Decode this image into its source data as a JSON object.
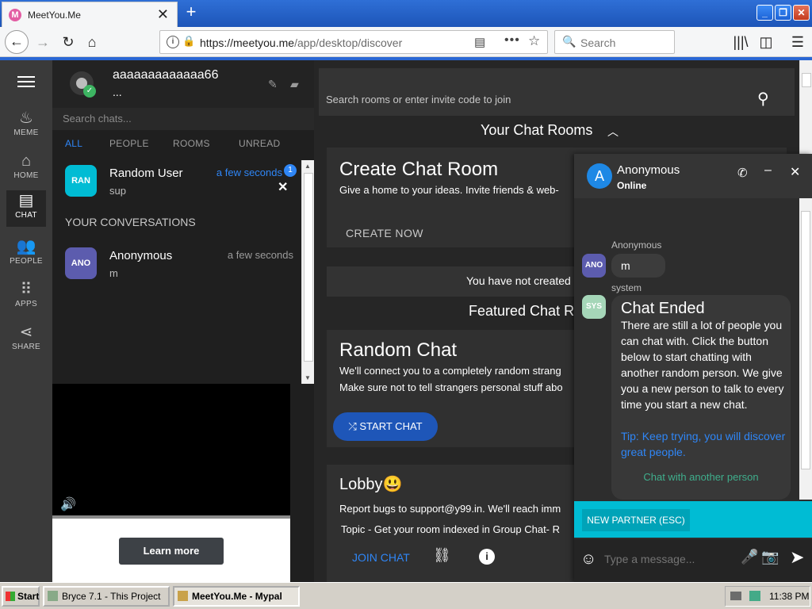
{
  "browser": {
    "tab_title": "MeetYou.Me",
    "tab_favicon_letter": "M",
    "url_host": "https://meetyou.me",
    "url_path": "/app/desktop/discover",
    "search_placeholder": "Search",
    "accent_color": "#2a67d4"
  },
  "rail": {
    "items": [
      {
        "label": "MEME",
        "icon": "fire-icon"
      },
      {
        "label": "HOME",
        "icon": "home-icon"
      },
      {
        "label": "CHAT",
        "icon": "chat-icon"
      },
      {
        "label": "PEOPLE",
        "icon": "people-icon"
      },
      {
        "label": "APPS",
        "icon": "apps-grid-icon"
      },
      {
        "label": "SHARE",
        "icon": "share-icon"
      }
    ],
    "active": "CHAT"
  },
  "user": {
    "name": "aaaaaaaaaaaaa66",
    "status": "..."
  },
  "chatlist": {
    "search_placeholder": "Search chats...",
    "filters": [
      "ALL",
      "PEOPLE",
      "ROOMS",
      "UNREAD"
    ],
    "active_filter": "ALL",
    "pinned": {
      "avatar": "RAN",
      "avatar_color": "#00bcd4",
      "name": "Random User",
      "message": "sup",
      "time": "a few seconds",
      "unread": "1"
    },
    "section_label": "YOUR CONVERSATIONS",
    "conversations": [
      {
        "avatar": "ANO",
        "avatar_color": "#5c5cae",
        "name": "Anonymous",
        "message": "m",
        "time": "a few seconds"
      }
    ]
  },
  "ad": {
    "button_label": "Learn more"
  },
  "discover": {
    "search_placeholder": "Search rooms or enter invite code to join",
    "your_rooms_heading": "Your Chat Rooms",
    "create_card": {
      "title": "Create Chat Room",
      "text": "Give a home to your ideas. Invite friends & web-",
      "action": "CREATE NOW"
    },
    "no_rooms_text": "You have not created",
    "featured_heading": "Featured Chat Ro",
    "random_card": {
      "title": "Random Chat",
      "line1": "We'll connect you to a completely random strang",
      "line2": "Make sure not to tell strangers personal stuff abo",
      "action": "START CHAT"
    },
    "lobby_card": {
      "title": "Lobby😃",
      "line1": "Report bugs to support@y99.in. We'll reach imm",
      "line2": "Topic - Get your room indexed in Group Chat- R",
      "action": "JOIN CHAT"
    }
  },
  "popup": {
    "avatar_letter": "A",
    "name": "Anonymous",
    "status": "Online",
    "messages": [
      {
        "sender": "Anonymous",
        "avatar": "ANO",
        "avatar_color": "#5c5cae",
        "text": "m"
      },
      {
        "sender": "system",
        "avatar": "SYS",
        "avatar_color": "#a5d6b8",
        "heading": "Chat Ended",
        "body": "There are still a lot of people you can chat with. Click the button below to start chatting with another random person. We give you a new person to talk to every time you start a new chat.",
        "tip": "Tip: Keep trying, you will discover great people.",
        "action": "Chat with another person"
      }
    ],
    "partner_button": "NEW PARTNER (ESC)",
    "input_placeholder": "Type a message..."
  },
  "taskbar": {
    "start_label": "Start",
    "items": [
      {
        "label": "Bryce 7.1 - This Project",
        "active": false
      },
      {
        "label": "MeetYou.Me - Mypal",
        "active": true
      }
    ],
    "clock": "11:38 PM"
  }
}
